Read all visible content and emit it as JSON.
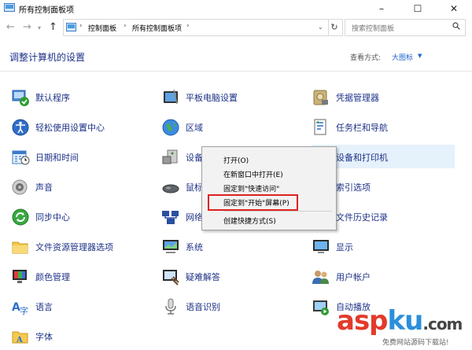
{
  "window": {
    "title": "所有控制面板项",
    "minimize": "–",
    "maximize": "☐",
    "close": "✕"
  },
  "address": {
    "crumbs": [
      "控制面板",
      "所有控制面板项"
    ],
    "search_placeholder": "搜索控制面板"
  },
  "header": {
    "title": "调整计算机的设置",
    "view_by_label": "查看方式:",
    "view_by_value": "大图标"
  },
  "items": [
    {
      "label": "默认程序",
      "icon": "default-programs-icon"
    },
    {
      "label": "平板电脑设置",
      "icon": "tablet-settings-icon"
    },
    {
      "label": "凭据管理器",
      "icon": "credential-manager-icon"
    },
    {
      "label": "轻松使用设置中心",
      "icon": "ease-of-access-icon"
    },
    {
      "label": "区域",
      "icon": "region-globe-icon"
    },
    {
      "label": "任务栏和导航",
      "icon": "taskbar-icon"
    },
    {
      "label": "日期和时间",
      "icon": "date-time-icon"
    },
    {
      "label": "设备管理器",
      "icon": "device-manager-icon"
    },
    {
      "label": "设备和打印机",
      "icon": "printer-icon"
    },
    {
      "label": "声音",
      "icon": "sound-icon"
    },
    {
      "label": "鼠标",
      "icon": "mouse-icon"
    },
    {
      "label": "索引选项",
      "icon": "indexing-icon"
    },
    {
      "label": "同步中心",
      "icon": "sync-center-icon"
    },
    {
      "label": "网络和共享中心",
      "icon": "network-icon"
    },
    {
      "label": "文件历史记录",
      "icon": "file-history-icon"
    },
    {
      "label": "文件资源管理器选项",
      "icon": "folder-options-icon"
    },
    {
      "label": "系统",
      "icon": "system-icon"
    },
    {
      "label": "显示",
      "icon": "display-icon"
    },
    {
      "label": "颜色管理",
      "icon": "color-management-icon"
    },
    {
      "label": "疑难解答",
      "icon": "troubleshooting-icon"
    },
    {
      "label": "用户帐户",
      "icon": "user-accounts-icon"
    },
    {
      "label": "语言",
      "icon": "language-icon"
    },
    {
      "label": "语音识别",
      "icon": "speech-recognition-icon"
    },
    {
      "label": "自动播放",
      "icon": "autoplay-icon"
    },
    {
      "label": "字体",
      "icon": "fonts-icon"
    }
  ],
  "context_menu": {
    "items": [
      "打开(O)",
      "在新窗口中打开(E)",
      "固定到\"快速访问\"",
      "固定到\"开始\"屏幕(P)",
      "创建快捷方式(S)"
    ]
  },
  "watermark": {
    "text": "aspku.com",
    "sub": "免费网站源码下载站!"
  },
  "colors": {
    "link": "#1e3287",
    "accent": "#1e64c8",
    "highlight": "#e5f1fb",
    "callout": "#e02020"
  }
}
